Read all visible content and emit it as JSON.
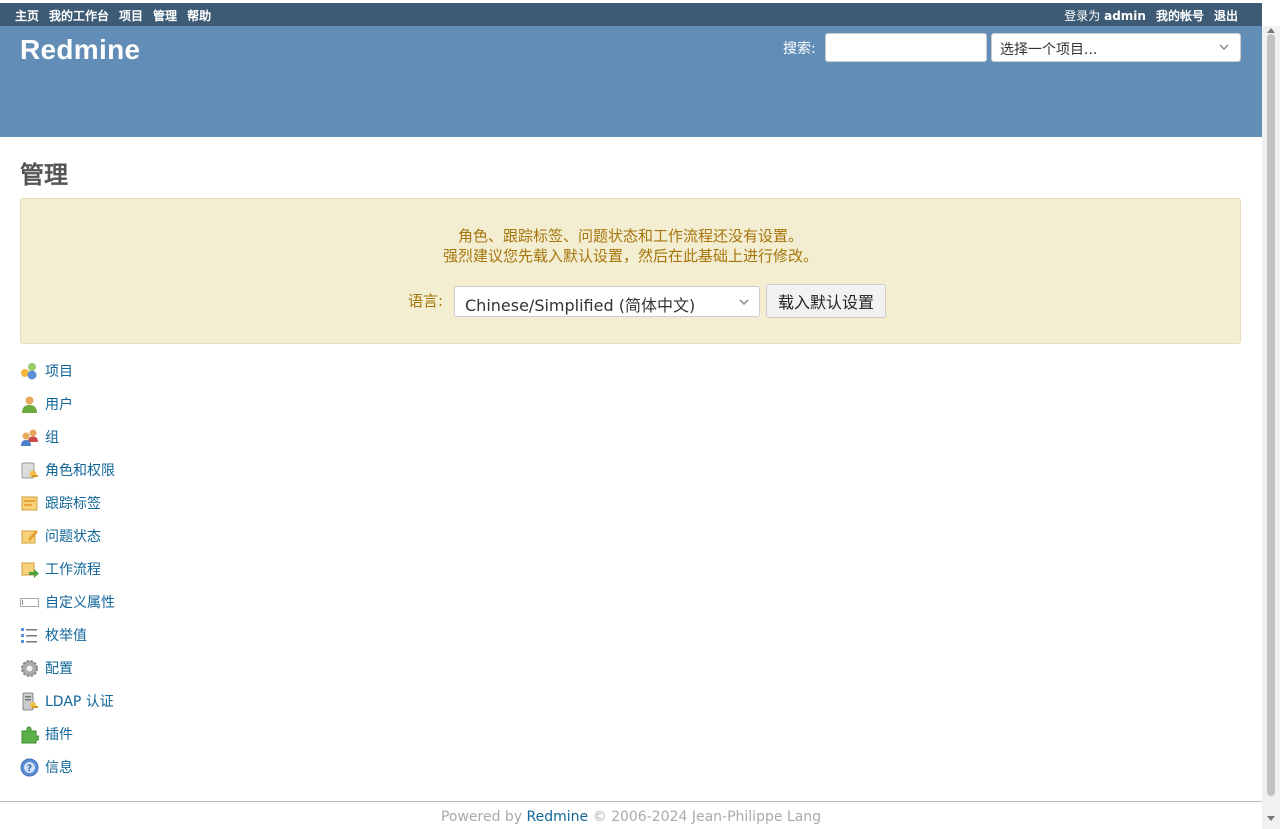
{
  "top_menu": {
    "left": [
      "主页",
      "我的工作台",
      "项目",
      "管理",
      "帮助"
    ],
    "logged_as_prefix": "登录为",
    "logged_as_user": "admin",
    "my_account": "我的帐号",
    "logout": "退出"
  },
  "header": {
    "title": "Redmine",
    "search_label": "搜索:",
    "search_value": "",
    "project_select": "选择一个项目..."
  },
  "content": {
    "heading": "管理",
    "notice": {
      "line1": "角色、跟踪标签、问题状态和工作流程还没有设置。",
      "line2": "强烈建议您先载入默认设置，然后在此基础上进行修改。",
      "language_label": "语言:",
      "language_value": "Chinese/Simplified (简体中文)",
      "load_button": "载入默认设置"
    },
    "admin_menu": [
      {
        "label": "项目",
        "icon": "projects-icon"
      },
      {
        "label": "用户",
        "icon": "user-icon"
      },
      {
        "label": "组",
        "icon": "group-icon"
      },
      {
        "label": "角色和权限",
        "icon": "roles-icon"
      },
      {
        "label": "跟踪标签",
        "icon": "tracker-icon"
      },
      {
        "label": "问题状态",
        "icon": "issue-status-icon"
      },
      {
        "label": "工作流程",
        "icon": "workflow-icon"
      },
      {
        "label": "自定义属性",
        "icon": "custom-field-icon"
      },
      {
        "label": "枚举值",
        "icon": "list-icon"
      },
      {
        "label": "配置",
        "icon": "gear-icon"
      },
      {
        "label": "LDAP 认证",
        "icon": "server-key-icon"
      },
      {
        "label": "插件",
        "icon": "plugin-icon"
      },
      {
        "label": "信息",
        "icon": "help-icon"
      }
    ]
  },
  "footer": {
    "powered_by": "Powered by",
    "redmine_link": "Redmine",
    "copyright": "© 2006-2024 Jean-Philippe Lang"
  },
  "colors": {
    "top_menu_bg": "#3e5b76",
    "header_bg": "#628db6",
    "notice_bg": "#f3edd1",
    "notice_text": "#a6750c",
    "link": "#116699"
  }
}
